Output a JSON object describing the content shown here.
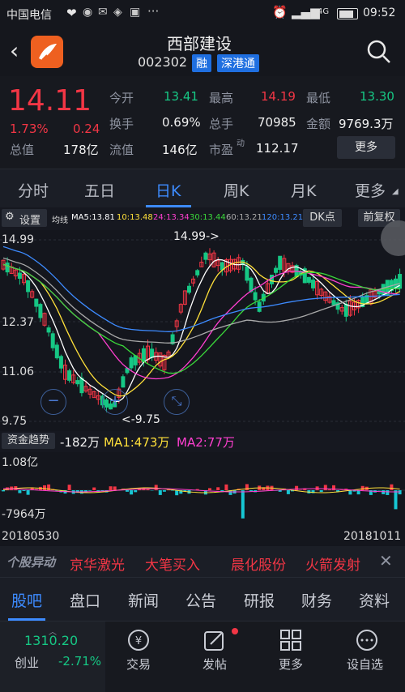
{
  "status_bar": {
    "carrier": "中国电信",
    "network": "4G",
    "time": "09:52"
  },
  "header": {
    "title": "西部建设",
    "code": "002302",
    "tag_margin": "融",
    "tag_connect": "深港通"
  },
  "quote": {
    "price": "14.11",
    "change_pct": "1.73%",
    "change_amt": "0.24",
    "open_label": "今开",
    "open": "13.41",
    "high_label": "最高",
    "high": "14.19",
    "low_label": "最低",
    "low": "13.30",
    "turnover_label": "换手",
    "turnover": "0.69%",
    "volume_label": "总手",
    "volume": "70985",
    "amount_label": "金额",
    "amount": "9769.3万",
    "mktcap_label": "总值",
    "mktcap": "178亿",
    "float_label": "流值",
    "float": "146亿",
    "pe_label": "市盈",
    "pe_sup": "动",
    "pe": "112.17",
    "more_label": "更多"
  },
  "period_tabs": {
    "intraday": "分时",
    "five_day": "五日",
    "daily": "日K",
    "weekly": "周K",
    "monthly": "月K",
    "more": "更多"
  },
  "chart_toolbar": {
    "settings": "设置",
    "ma_label": "均线",
    "ma5": "MA5:13.81",
    "ma10": "10:13.48",
    "ma24": "24:13.34",
    "ma30": "30:13.44",
    "ma60": "60:13.21",
    "ma120": "120:13.21",
    "dk": "DK点",
    "adjust": "前复权"
  },
  "chart_data": {
    "type": "candlestick",
    "y_ticks": [
      "14.99",
      "12.37",
      "11.06",
      "9.75"
    ],
    "high_marker": "14.99->",
    "low_marker": "<-9.75",
    "x_start": "20180530",
    "x_end": "20181011",
    "ylim": [
      9.75,
      14.99
    ]
  },
  "fund_bar": {
    "label": "资金趋势",
    "value": "-182万",
    "ma1": "MA1:473万",
    "ma2": "MA2:77万"
  },
  "fund_axis": {
    "top": "1.08亿",
    "bottom": "-7964万"
  },
  "hot": {
    "logo": "个股异动",
    "items": [
      "京华激光",
      "大笔买入",
      "晨化股份",
      "火箭发射"
    ]
  },
  "bottom_tabs": [
    "股吧",
    "盘口",
    "新闻",
    "公告",
    "研报",
    "财务",
    "资料"
  ],
  "index_widget": {
    "value": "1310.20",
    "name": "创业",
    "change": "-2.71%"
  },
  "bottom_nav": {
    "trade": "交易",
    "post": "发帖",
    "more": "更多",
    "watch": "设自选"
  },
  "colors": {
    "up": "#f23645",
    "down": "#16c784",
    "accent": "#3d8bff",
    "bg": "#131722"
  }
}
